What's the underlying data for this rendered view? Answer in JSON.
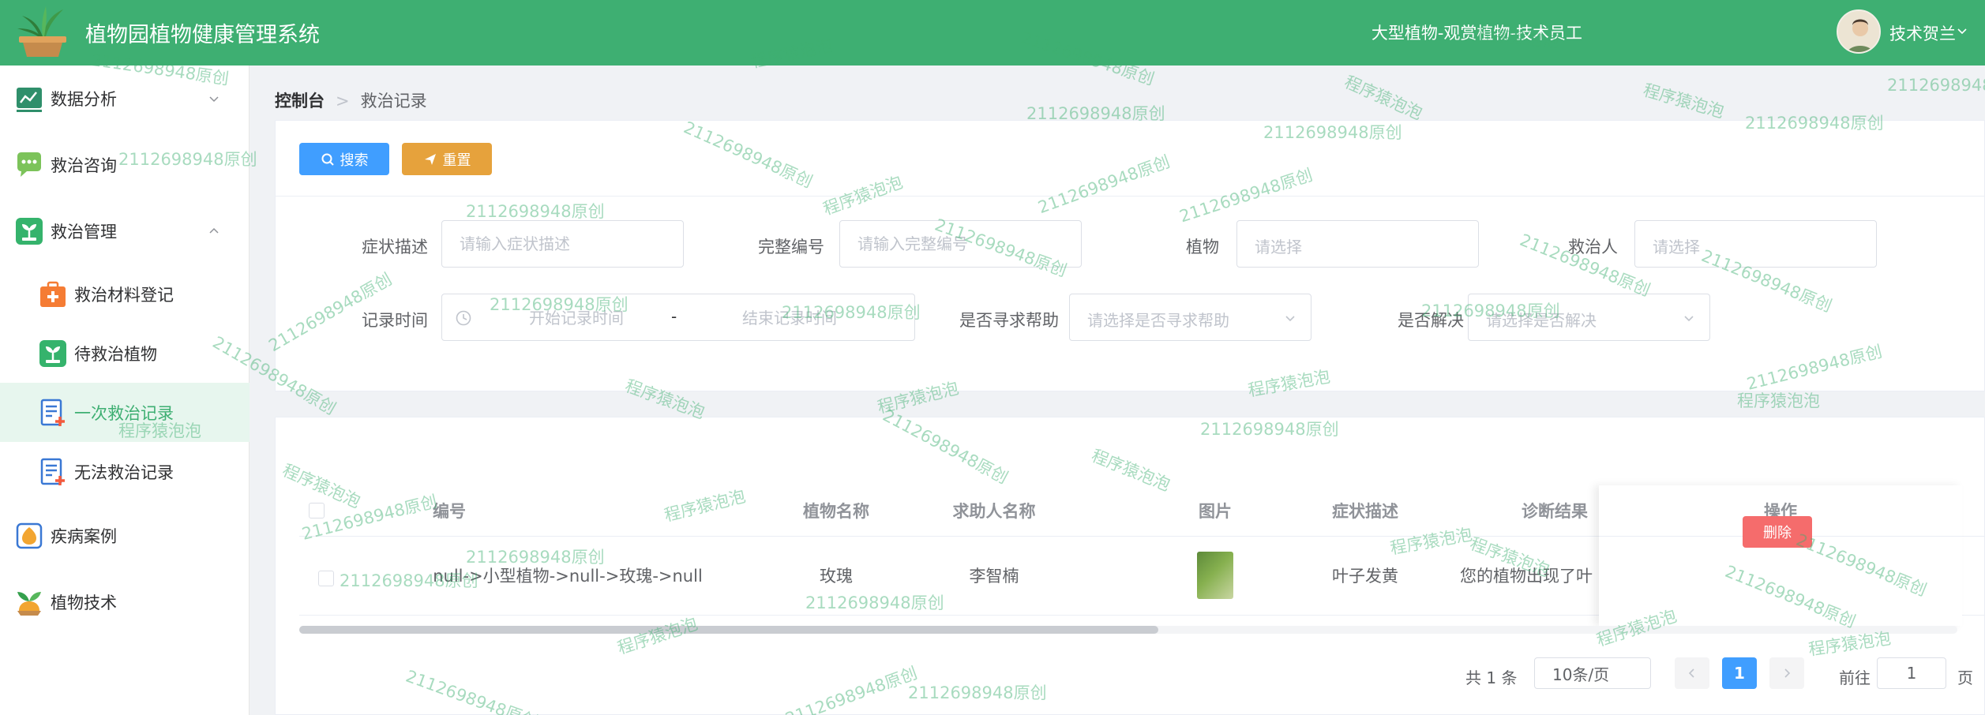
{
  "header": {
    "title": "植物园植物健康管理系统",
    "user_role": "大型植物-观赏植物-技术员工",
    "user_name": "技术贺兰"
  },
  "sidebar": {
    "items": [
      {
        "label": "数据分析",
        "icon": "chart-icon",
        "expanded": false
      },
      {
        "label": "救治咨询",
        "icon": "chat-bubble-icon"
      },
      {
        "label": "救治管理",
        "icon": "plant-care-icon",
        "expanded": true,
        "children": [
          {
            "label": "救治材料登记",
            "icon": "medkit-icon"
          },
          {
            "label": "待救治植物",
            "icon": "plant-icon"
          },
          {
            "label": "一次救治记录",
            "icon": "record-icon",
            "active": true
          },
          {
            "label": "无法救治记录",
            "icon": "record-icon"
          }
        ]
      },
      {
        "label": "疾病案例",
        "icon": "case-icon"
      },
      {
        "label": "植物技术",
        "icon": "tech-icon"
      }
    ]
  },
  "breadcrumb": {
    "home": "控制台",
    "current": "救治记录"
  },
  "search": {
    "search_label": "搜索",
    "reset_label": "重置",
    "fields": {
      "symptom": {
        "label": "症状描述",
        "placeholder": "请输入症状描述"
      },
      "full_code": {
        "label": "完整编号",
        "placeholder": "请输入完整编号"
      },
      "plant": {
        "label": "植物",
        "placeholder": "请选择"
      },
      "rescuer": {
        "label": "救治人",
        "placeholder": "请选择"
      },
      "record_time": {
        "label": "记录时间",
        "start_placeholder": "开始记录时间",
        "separator": "-",
        "end_placeholder": "结束记录时间"
      },
      "seek_help": {
        "label": "是否寻求帮助",
        "placeholder": "请选择是否寻求帮助"
      },
      "resolved": {
        "label": "是否解决",
        "placeholder": "请选择是否解决"
      }
    }
  },
  "table": {
    "columns": [
      "编号",
      "植物名称",
      "求助人名称",
      "图片",
      "症状描述",
      "诊断结果",
      "操作"
    ],
    "rows": [
      {
        "code": "null->小型植物->null->玫瑰->null",
        "plant_name": "玫瑰",
        "requester": "李智楠",
        "symptom": "叶子发黄",
        "diagnosis": "您的植物出现了叶",
        "delete_label": "删除"
      }
    ]
  },
  "pagination": {
    "total_text": "共 1 条",
    "page_size": "10条/页",
    "current_page": "1",
    "goto_label": "前往",
    "goto_value": "1",
    "page_unit": "页"
  },
  "colors": {
    "brand": "#3eaf72",
    "primary": "#409eff",
    "warning": "#e6a23c",
    "danger": "#f56c6c"
  },
  "watermarks": {
    "a": "2112698948原创",
    "b": "程序猿泡泡"
  }
}
